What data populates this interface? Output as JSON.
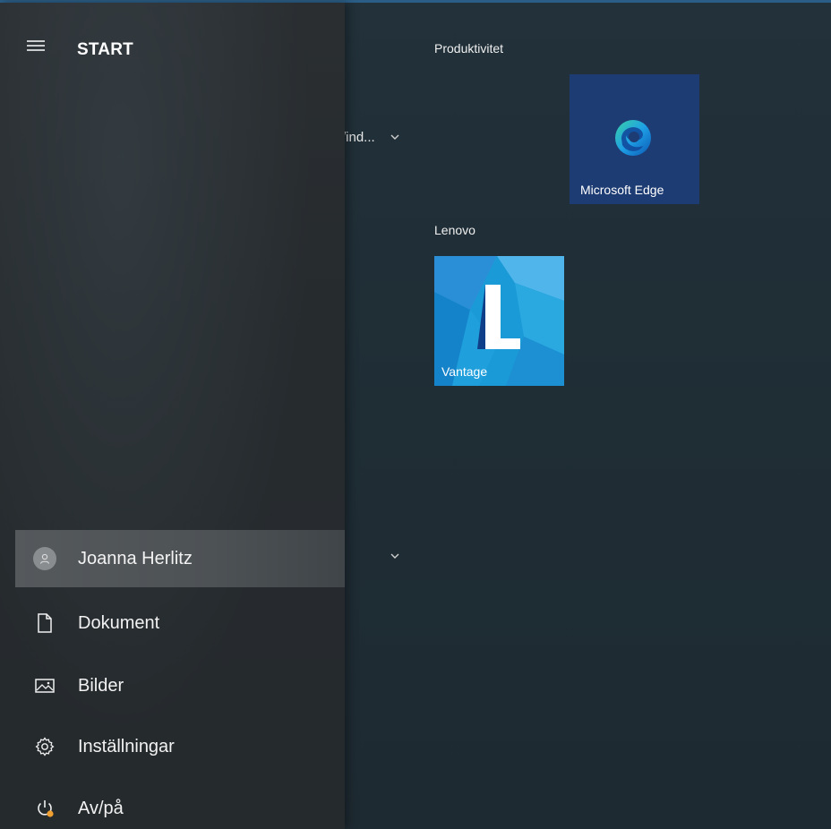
{
  "nav": {
    "title": "START",
    "items": [
      {
        "label": "Joanna Herlitz",
        "icon": "user-avatar-icon"
      },
      {
        "label": "Dokument",
        "icon": "document-icon"
      },
      {
        "label": "Bilder",
        "icon": "pictures-icon"
      },
      {
        "label": "Inställningar",
        "icon": "gear-icon"
      },
      {
        "label": "Av/på",
        "icon": "power-icon"
      }
    ]
  },
  "app_list": {
    "peek_text": "/ind..."
  },
  "tiles": {
    "groups": [
      {
        "name": "Produktivitet",
        "tiles": [
          {
            "label": "Microsoft Edge",
            "icon": "edge-icon",
            "color": "#1d3c73"
          }
        ]
      },
      {
        "name": "Lenovo",
        "tiles": [
          {
            "label": "Vantage",
            "icon": "lenovo-vantage-icon",
            "color": "#1a9ad6"
          }
        ]
      }
    ]
  },
  "colors": {
    "accent": "#2b5e86",
    "power_badge": "#f0a030"
  }
}
